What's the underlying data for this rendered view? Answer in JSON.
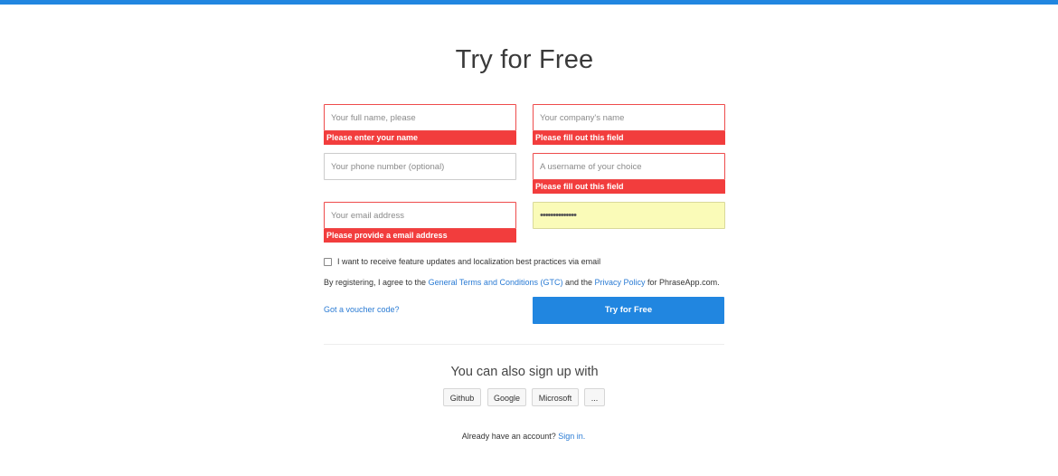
{
  "page": {
    "title": "Try for Free",
    "accent_color": "#2186e0",
    "error_color": "#f23d3d"
  },
  "form": {
    "full_name": {
      "placeholder": "Your full name, please",
      "value": "",
      "error": "Please enter your name"
    },
    "company": {
      "placeholder": "Your company's name",
      "value": "",
      "error": "Please fill out this field"
    },
    "phone": {
      "placeholder": "Your phone number (optional)",
      "value": ""
    },
    "username": {
      "placeholder": "A username of your choice",
      "value": "",
      "error": "Please fill out this field"
    },
    "email": {
      "placeholder": "Your email address",
      "value": "",
      "error": "Please provide a email address"
    },
    "password": {
      "value": "••••••••••••••"
    },
    "newsletter_label": "I want to receive feature updates and localization best practices via email",
    "terms": {
      "prefix": "By registering, I agree to the ",
      "gtc_link": "General Terms and Conditions (GTC)",
      "middle": " and the ",
      "privacy_link": "Privacy Policy",
      "suffix": " for PhraseApp.com."
    },
    "voucher_link": "Got a voucher code?",
    "submit_label": "Try for Free"
  },
  "alt_signup": {
    "heading": "You can also sign up with",
    "providers": [
      "Github",
      "Google",
      "Microsoft",
      "..."
    ]
  },
  "signin": {
    "prompt": "Already have an account? ",
    "link": "Sign in."
  }
}
